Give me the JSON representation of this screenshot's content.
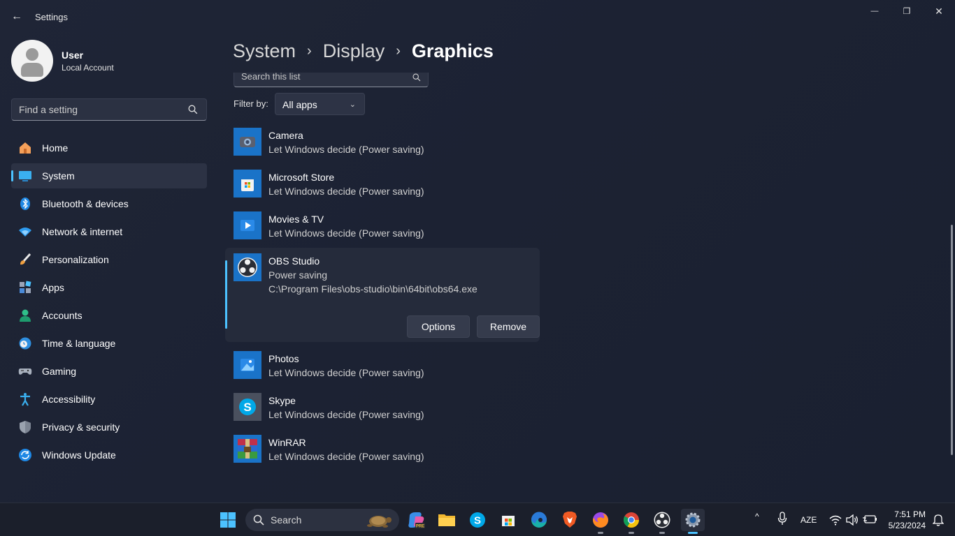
{
  "window": {
    "title": "Settings",
    "back_glyph": "←",
    "minimize_glyph": "—",
    "maximize_glyph": "❐",
    "close_glyph": "✕"
  },
  "user": {
    "name": "User",
    "account_type": "Local Account"
  },
  "search": {
    "placeholder": "Find a setting"
  },
  "sidebar": {
    "items": [
      {
        "label": "Home",
        "icon": "home-icon"
      },
      {
        "label": "System",
        "icon": "system-icon",
        "active": true
      },
      {
        "label": "Bluetooth & devices",
        "icon": "bluetooth-icon"
      },
      {
        "label": "Network & internet",
        "icon": "wifi-icon"
      },
      {
        "label": "Personalization",
        "icon": "brush-icon"
      },
      {
        "label": "Apps",
        "icon": "apps-icon"
      },
      {
        "label": "Accounts",
        "icon": "accounts-icon"
      },
      {
        "label": "Time & language",
        "icon": "clock-globe-icon"
      },
      {
        "label": "Gaming",
        "icon": "gamepad-icon"
      },
      {
        "label": "Accessibility",
        "icon": "accessibility-icon"
      },
      {
        "label": "Privacy & security",
        "icon": "shield-icon"
      },
      {
        "label": "Windows Update",
        "icon": "update-icon"
      }
    ]
  },
  "breadcrumb": {
    "items": [
      "System",
      "Display",
      "Graphics"
    ],
    "separator": "›"
  },
  "list_search": {
    "placeholder": "Search this list"
  },
  "filter": {
    "label": "Filter by:",
    "value": "All apps",
    "chevron": "⌄"
  },
  "apps": [
    {
      "name": "Camera",
      "preference": "Let Windows decide (Power saving)",
      "icon": "camera-app-icon"
    },
    {
      "name": "Microsoft Store",
      "preference": "Let Windows decide (Power saving)",
      "icon": "store-app-icon"
    },
    {
      "name": "Movies & TV",
      "preference": "Let Windows decide (Power saving)",
      "icon": "movies-app-icon"
    },
    {
      "name": "OBS Studio",
      "preference": "Power saving",
      "path": "C:\\Program Files\\obs-studio\\bin\\64bit\\obs64.exe",
      "icon": "obs-app-icon",
      "expanded": true,
      "options_label": "Options",
      "remove_label": "Remove"
    },
    {
      "name": "Photos",
      "preference": "Let Windows decide (Power saving)",
      "icon": "photos-app-icon"
    },
    {
      "name": "Skype",
      "preference": "Let Windows decide (Power saving)",
      "icon": "skype-app-icon"
    },
    {
      "name": "WinRAR",
      "preference": "Let Windows decide (Power saving)",
      "icon": "winrar-app-icon"
    }
  ],
  "taskbar": {
    "search_label": "Search",
    "language": "AZE",
    "time": "7:51 PM",
    "date": "5/23/2024",
    "tray_chevron": "^"
  },
  "colors": {
    "accent": "#4cc2ff",
    "background": "#1f2536"
  }
}
